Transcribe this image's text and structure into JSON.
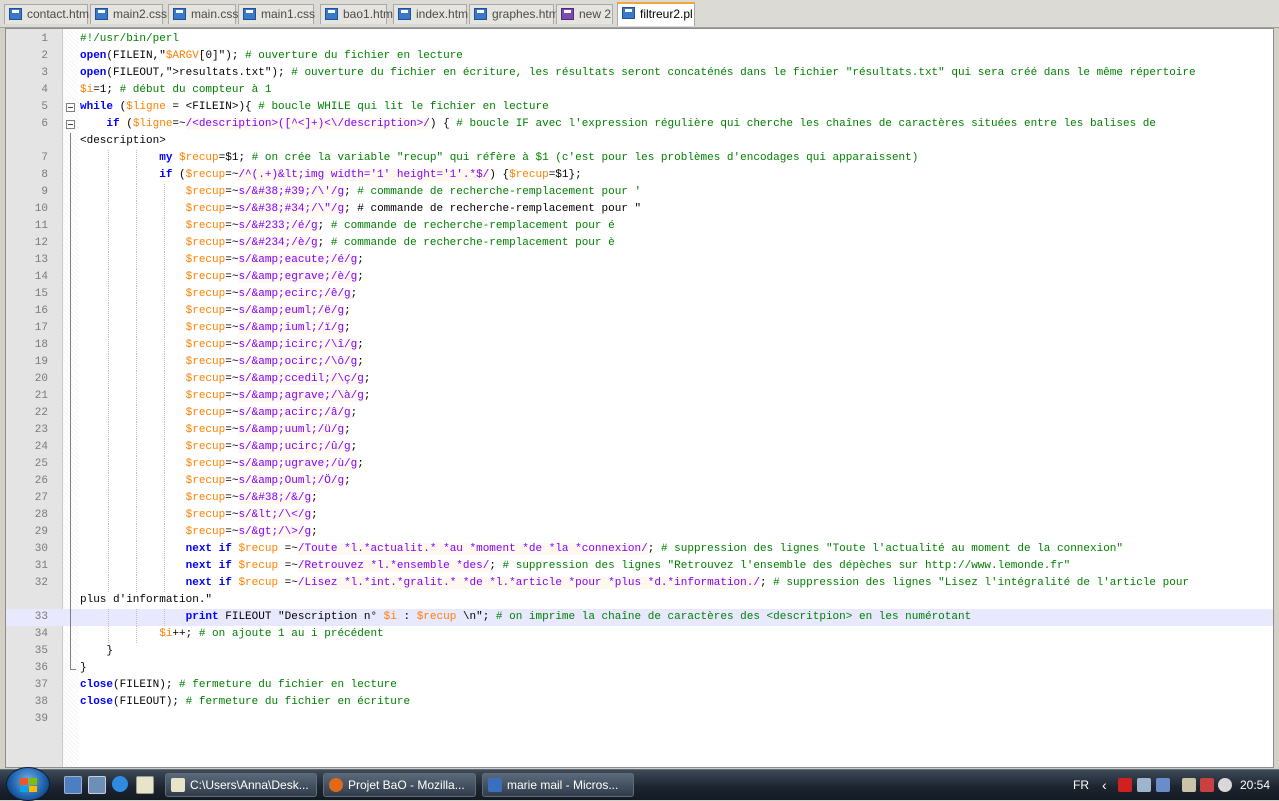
{
  "tabs": [
    {
      "label": "contact.htm",
      "modified": false,
      "active": false
    },
    {
      "label": "main2.css",
      "modified": false,
      "active": false
    },
    {
      "label": "main.css",
      "modified": false,
      "active": false
    },
    {
      "label": "main1.css",
      "modified": false,
      "active": false
    },
    {
      "label": "bao1.htm",
      "modified": false,
      "active": false
    },
    {
      "label": "index.htm",
      "modified": false,
      "active": false
    },
    {
      "label": "graphes.htm",
      "modified": false,
      "active": false
    },
    {
      "label": "new 2",
      "modified": true,
      "active": false
    },
    {
      "label": "filtreur2.pl",
      "modified": false,
      "active": true
    }
  ],
  "editor": {
    "current_line": 33,
    "lines": [
      {
        "n": "1",
        "text": "#!/usr/bin/perl"
      },
      {
        "n": "2",
        "text": "open(FILEIN,\"$ARGV[0]\"); # ouverture du fichier en lecture"
      },
      {
        "n": "3",
        "text": "open(FILEOUT,\">resultats.txt\"); # ouverture du fichier en écriture, les résultats seront concaténés dans le fichier \"résultats.txt\" qui sera créé dans le même répertoire"
      },
      {
        "n": "4",
        "text": "$i=1; # début du compteur à 1"
      },
      {
        "n": "5",
        "text": "while ($ligne = <FILEIN>){ # boucle WHILE qui lit le fichier en lecture"
      },
      {
        "n": "6",
        "text": "    if ($ligne=~/<description>([^<]+)<\\/description>/) { # boucle IF avec l'expression régulière qui cherche les chaînes de caractères situées entre les balises de"
      },
      {
        "n": "",
        "text": "<description>"
      },
      {
        "n": "7",
        "text": "            my $recup=$1; # on crée la variable \"recup\" qui réfère à $1 (c'est pour les problèmes d'encodages qui apparaissent)"
      },
      {
        "n": "8",
        "text": "            if ($recup=~/^(.+)&lt;img width='1' height='1'.*$/) {$recup=$1};"
      },
      {
        "n": "9",
        "text": "                $recup=~s/&#38;#39;/\\'/g; # commande de recherche-remplacement pour '"
      },
      {
        "n": "10",
        "text": "                $recup=~s/&#38;#34;/\\\"/g; # commande de recherche-remplacement pour \""
      },
      {
        "n": "11",
        "text": "                $recup=~s/&#233;/é/g; # commande de recherche-remplacement pour é"
      },
      {
        "n": "12",
        "text": "                $recup=~s/&#234;/è/g; # commande de recherche-remplacement pour è"
      },
      {
        "n": "13",
        "text": "                $recup=~s/&amp;eacute;/é/g;"
      },
      {
        "n": "14",
        "text": "                $recup=~s/&amp;egrave;/è/g;"
      },
      {
        "n": "15",
        "text": "                $recup=~s/&amp;ecirc;/ê/g;"
      },
      {
        "n": "16",
        "text": "                $recup=~s/&amp;euml;/ë/g;"
      },
      {
        "n": "17",
        "text": "                $recup=~s/&amp;iuml;/ï/g;"
      },
      {
        "n": "18",
        "text": "                $recup=~s/&amp;icirc;/\\î/g;"
      },
      {
        "n": "19",
        "text": "                $recup=~s/&amp;ocirc;/\\ô/g;"
      },
      {
        "n": "20",
        "text": "                $recup=~s/&amp;ccedil;/\\ç/g;"
      },
      {
        "n": "21",
        "text": "                $recup=~s/&amp;agrave;/\\à/g;"
      },
      {
        "n": "22",
        "text": "                $recup=~s/&amp;acirc;/â/g;"
      },
      {
        "n": "23",
        "text": "                $recup=~s/&amp;uuml;/ü/g;"
      },
      {
        "n": "24",
        "text": "                $recup=~s/&amp;ucirc;/û/g;"
      },
      {
        "n": "25",
        "text": "                $recup=~s/&amp;ugrave;/ù/g;"
      },
      {
        "n": "26",
        "text": "                $recup=~s/&amp;Ouml;/Ö/g;"
      },
      {
        "n": "27",
        "text": "                $recup=~s/&#38;/&/g;"
      },
      {
        "n": "28",
        "text": "                $recup=~s/&lt;/\\</g;"
      },
      {
        "n": "29",
        "text": "                $recup=~s/&gt;/\\>/g;"
      },
      {
        "n": "30",
        "text": "                next if $recup =~/Toute *l.*actualit.* *au *moment *de *la *connexion/; # suppression des lignes \"Toute l'actualité au moment de la connexion\""
      },
      {
        "n": "31",
        "text": "                next if $recup =~/Retrouvez *l.*ensemble *des/; # suppression des lignes \"Retrouvez l'ensemble des dépèches sur http://www.lemonde.fr\""
      },
      {
        "n": "32",
        "text": "                next if $recup =~/Lisez *l.*int.*gralit.* *de *l.*article *pour *plus *d.*information./; # suppression des lignes \"Lisez l'intégralité de l'article pour"
      },
      {
        "n": "",
        "text": "plus d'information.\""
      },
      {
        "n": "33",
        "text": "                print FILEOUT \"Description n° $i : $recup \\n\"; # on imprime la chaîne de caractères des <descritpion> en les numérotant"
      },
      {
        "n": "34",
        "text": "            $i++; # on ajoute 1 au i précédent"
      },
      {
        "n": "35",
        "text": "    }"
      },
      {
        "n": "36",
        "text": "}"
      },
      {
        "n": "37",
        "text": "close(FILEIN); # fermeture du fichier en lecture"
      },
      {
        "n": "38",
        "text": "close(FILEOUT); # fermeture du fichier en écriture"
      },
      {
        "n": "39",
        "text": ""
      }
    ]
  },
  "taskbar": {
    "items": [
      {
        "label": "C:\\Users\\Anna\\Desk...",
        "icon": "notepad-icon"
      },
      {
        "label": "Projet BaO - Mozilla...",
        "icon": "firefox-icon"
      },
      {
        "label": "marie mail - Micros...",
        "icon": "word-icon"
      }
    ],
    "language": "FR",
    "clock": "20:54"
  },
  "colors": {
    "keyword": "#0000ff",
    "comment": "#008000",
    "variable": "#ff8000",
    "regex": "#8000ff",
    "active_tab_accent": "#f2a53b"
  }
}
